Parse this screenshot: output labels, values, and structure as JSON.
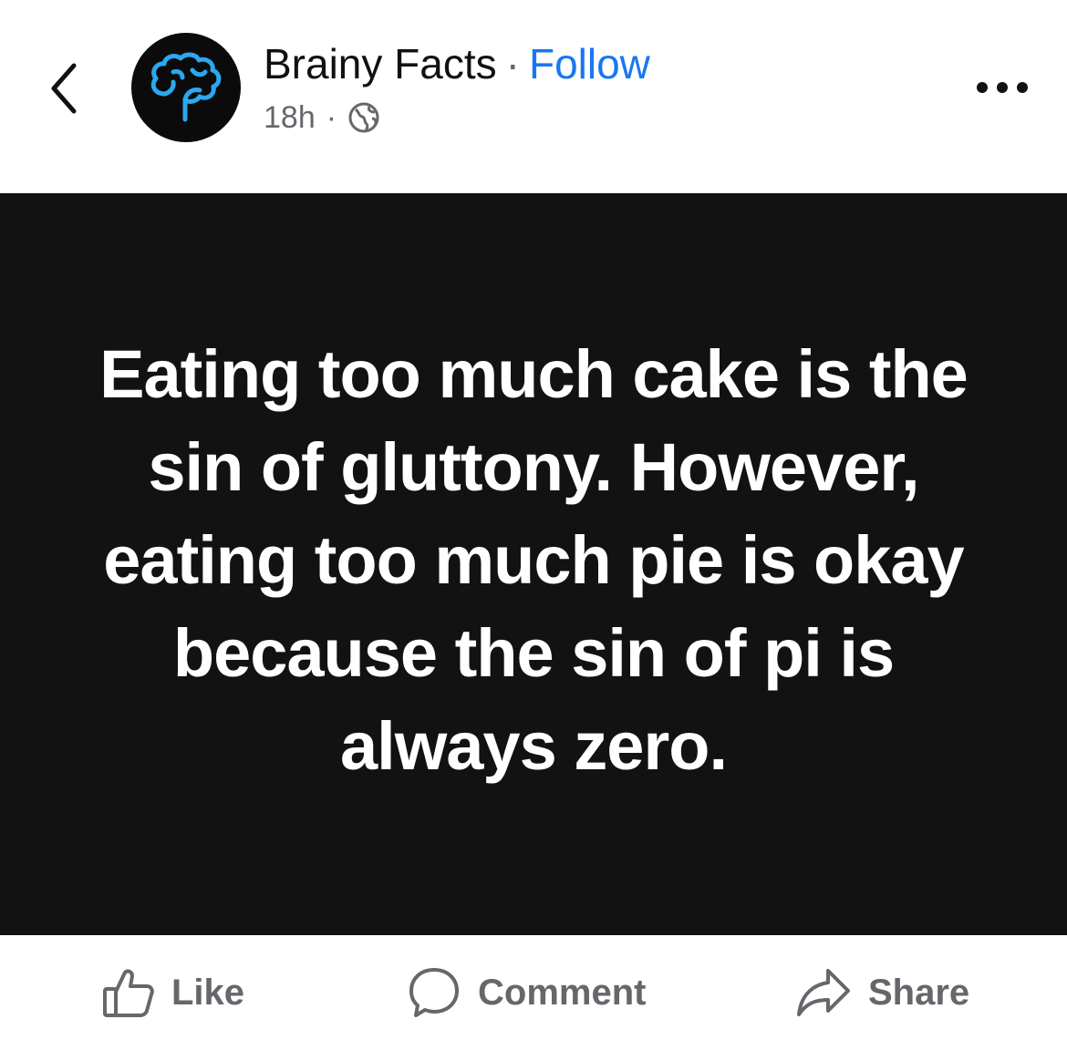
{
  "header": {
    "back_icon": "chevron-left-icon",
    "avatar_icon": "brain-icon",
    "page_name": "Brainy Facts",
    "separator": "·",
    "follow_label": "Follow",
    "time_ago": "18h",
    "meta_separator": "·",
    "privacy_icon": "globe-icon",
    "more_icon": "more-horizontal-icon"
  },
  "post": {
    "text": "Eating too much cake is the sin of gluttony. However, eating too much pie is okay because the sin of pi is always zero."
  },
  "actions": {
    "like_label": "Like",
    "comment_label": "Comment",
    "share_label": "Share"
  },
  "colors": {
    "accent": "#1877f2",
    "muted": "#65676b",
    "post_background": "#121212",
    "post_text": "#ffffff",
    "brain_icon": "#2aa8f0"
  }
}
